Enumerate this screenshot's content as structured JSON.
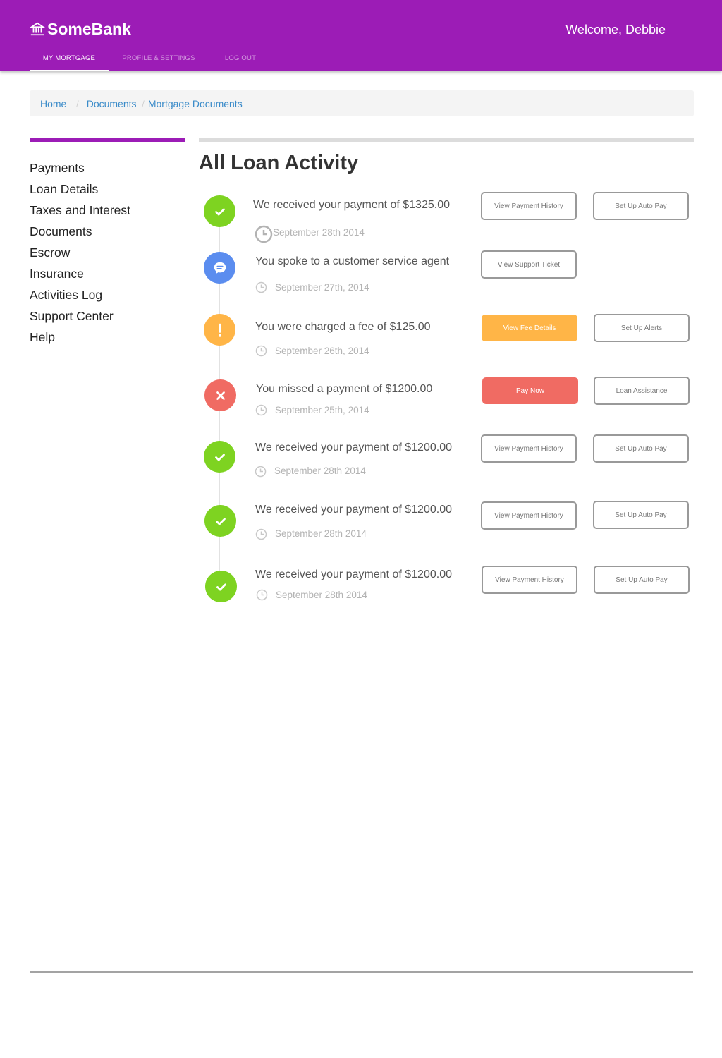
{
  "header": {
    "brand": "SomeBank",
    "brand_icon": "bank-icon",
    "welcome": "Welcome, Debbie",
    "tabs": [
      {
        "label": "MY MORTGAGE",
        "active": true
      },
      {
        "label": "PROFILE & SETTINGS",
        "active": false
      },
      {
        "label": "LOG OUT",
        "active": false
      }
    ],
    "color": "#9c1cb6"
  },
  "breadcrumb": [
    "Home",
    "Documents",
    "Mortgage Documents"
  ],
  "sidebar": {
    "items": [
      "Payments",
      "Loan Details",
      "Taxes and Interest",
      "Documents",
      "Escrow",
      "Insurance",
      "Activities Log",
      "Support Center",
      "Help"
    ]
  },
  "main": {
    "title": "All Loan Activity",
    "activities": [
      {
        "status": "success",
        "icon": "check-icon",
        "color": "#7ed321",
        "message": "We received your payment of $1325.00",
        "date": "September 28th 2014",
        "buttons": [
          "View Payment History",
          "Set Up Auto Pay"
        ]
      },
      {
        "status": "support",
        "icon": "chat-icon",
        "color": "#5b8def",
        "message": "You spoke to a customer service agent",
        "date": "September 27th, 2014",
        "buttons": [
          "View Support Ticket"
        ]
      },
      {
        "status": "warning",
        "icon": "exclamation-icon",
        "color": "#ffb547",
        "message": "You were charged a fee of $125.00",
        "date": "September 26th, 2014",
        "buttons": [
          "View Fee Details",
          "Set Up Alerts"
        ]
      },
      {
        "status": "error",
        "icon": "x-icon",
        "color": "#f06b63",
        "message": "You missed a payment of $1200.00",
        "date": "September 25th, 2014",
        "buttons": [
          "Pay Now",
          "Loan Assistance"
        ]
      },
      {
        "status": "success",
        "icon": "check-icon",
        "color": "#7ed321",
        "message": "We received your payment of $1200.00",
        "date": "September 28th 2014",
        "buttons": [
          "View Payment History",
          "Set Up Auto Pay"
        ]
      },
      {
        "status": "success",
        "icon": "check-icon",
        "color": "#7ed321",
        "message": "We received your payment of $1200.00",
        "date": "September 28th 2014",
        "buttons": [
          "View Payment History",
          "Set Up Auto Pay"
        ]
      },
      {
        "status": "success",
        "icon": "check-icon",
        "color": "#7ed321",
        "message": "We received your payment of $1200.00",
        "date": "September 28th 2014",
        "buttons": [
          "View Payment History",
          "Set Up Auto Pay"
        ]
      }
    ]
  }
}
